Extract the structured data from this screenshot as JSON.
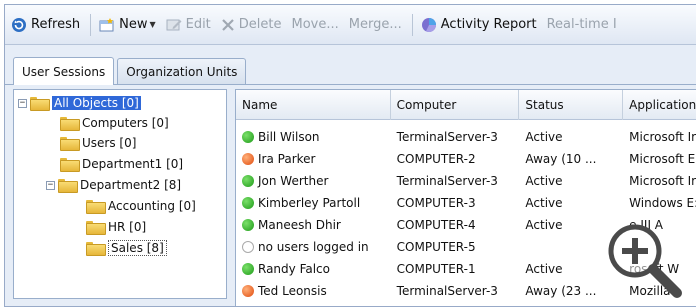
{
  "toolbar": {
    "items": [
      {
        "label": "Refresh",
        "icon": "refresh-icon",
        "enabled": true
      },
      {
        "label": "New",
        "icon": "new-icon",
        "enabled": true
      },
      {
        "label": "Edit",
        "icon": "edit-icon",
        "enabled": false
      },
      {
        "label": "Delete",
        "icon": "delete-icon",
        "enabled": false
      },
      {
        "label": "Move...",
        "enabled": false
      },
      {
        "label": "Merge...",
        "enabled": false
      },
      {
        "label": "Activity Report",
        "icon": "activity-report-icon",
        "enabled": true
      },
      {
        "label": "Real-time I",
        "enabled": false
      }
    ]
  },
  "tabs": [
    {
      "label": "User Sessions",
      "active": true
    },
    {
      "label": "Organization Units",
      "active": false
    }
  ],
  "tree": {
    "nodes": [
      {
        "label": "All Objects [0]",
        "selected": true,
        "toggle": "−"
      },
      {
        "label": "Computers [0]"
      },
      {
        "label": "Users [0]"
      },
      {
        "label": "Department1 [0]"
      },
      {
        "label": "Department2 [8]",
        "toggle": "−"
      },
      {
        "label": "Accounting [0]"
      },
      {
        "label": "HR [0]"
      },
      {
        "label": "Sales [8]",
        "boxed": true
      }
    ]
  },
  "grid": {
    "columns": [
      "Name",
      "Computer",
      "Status",
      "Application"
    ],
    "rows": [
      {
        "name": "Bill Wilson",
        "computer": "TerminalServer-3",
        "status": "Active",
        "application": "Microsoft Ir",
        "status_color": "green"
      },
      {
        "name": "Ira Parker",
        "computer": "COMPUTER-2",
        "status": "Away (10 ...",
        "application": "Microsoft E",
        "status_color": "orange"
      },
      {
        "name": "Jon Werther",
        "computer": "TerminalServer-3",
        "status": "Active",
        "application": "Microsoft Ir",
        "status_color": "green"
      },
      {
        "name": "Kimberley Partoll",
        "computer": "COMPUTER-3",
        "status": "Active",
        "application": "Windows E:",
        "status_color": "green"
      },
      {
        "name": "Maneesh Dhir",
        "computer": "COMPUTER-4",
        "status": "Active",
        "application": "e III A",
        "status_color": "green"
      },
      {
        "name": "no users logged in",
        "computer": "COMPUTER-5",
        "status": "",
        "application": "",
        "status_color": "gray"
      },
      {
        "name": "Randy Falco",
        "computer": "COMPUTER-1",
        "status": "Active",
        "application": "rosoft W",
        "status_color": "green"
      },
      {
        "name": "Ted Leonsis",
        "computer": "TerminalServer-3",
        "status": "Away (23 ...",
        "application": "Mozilla",
        "status_color": "orange"
      }
    ]
  },
  "overlay": {
    "icon": "zoom-in-magnifier-icon"
  }
}
